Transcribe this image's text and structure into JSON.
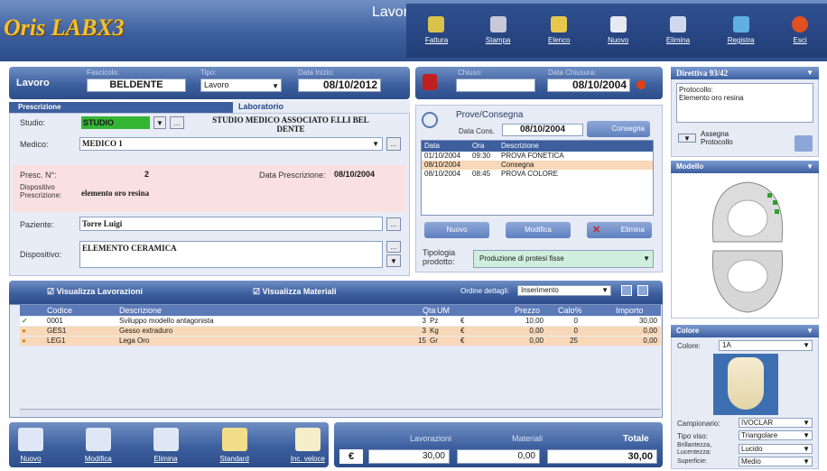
{
  "header": {
    "logo": "Oris LABX3",
    "title": "Lavori",
    "toolbar": [
      {
        "label": "Fattura",
        "icon": "invoice-icon",
        "color": "#d9c24a"
      },
      {
        "label": "Stampa",
        "icon": "print-icon",
        "color": "#c8c8d8"
      },
      {
        "label": "Elenco",
        "icon": "list-icon",
        "color": "#e7c84d"
      },
      {
        "label": "Nuovo",
        "icon": "new-icon",
        "color": "#e8e8f0"
      },
      {
        "label": "Elimina",
        "icon": "delete-icon",
        "color": "#d0d8ee"
      },
      {
        "label": "Registra",
        "icon": "save-icon",
        "color": "#5fb0e0"
      },
      {
        "label": "Esci",
        "icon": "exit-icon",
        "color": "#e05020"
      }
    ]
  },
  "lavoro": {
    "title": "Lavoro",
    "fascicolo_label": "Fascicolo:",
    "fascicolo": "BELDENTE",
    "tipo_label": "Tipo:",
    "tipo": "Lavoro",
    "data_inizio_label": "Data Inizio:",
    "data_inizio": "08/10/2012"
  },
  "chiusura": {
    "chiuso_label": "Chiuso:",
    "chiuso": "",
    "data_label": "Data Chiusura:",
    "data": "08/10/2004"
  },
  "tabs": {
    "prescrizione": "Prescrizione",
    "laboratorio": "Laboratorio"
  },
  "form": {
    "studio_label": "Studio:",
    "studio": "STUDIO",
    "studio_name": "STUDIO MEDICO ASSOCIATO F.LLI BEL DENTE",
    "medico_label": "Medico:",
    "medico": "MEDICO 1",
    "presc_label": "Presc. N°:",
    "presc": "2",
    "data_presc_label": "Data Prescrizione:",
    "data_presc": "08/10/2004",
    "disp_presc_label": "Dispositivo Prescrizione:",
    "disp_presc": "elemento oro resina",
    "paziente_label": "Paziente:",
    "paziente": "Torre Luigi",
    "dispositivo_label": "Dispositivo:",
    "dispositivo": "ELEMENTO CERAMICA",
    "dots": "..."
  },
  "prove": {
    "title": "Prove/Consegna",
    "data_cons_label": "Data Cons.",
    "data_cons": "08/10/2004",
    "consegna_btn": "Consegna",
    "cols": [
      "Data",
      "Ora",
      "Descrizione"
    ],
    "rows": [
      [
        "01/10/2004",
        "09:30",
        "PROVA FONETICA"
      ],
      [
        "08/10/2004",
        "",
        "Consegna"
      ],
      [
        "08/10/2004",
        "08:45",
        "PROVA COLORE"
      ]
    ],
    "btn_nuovo": "Nuovo",
    "btn_modifica": "Modifica",
    "btn_elimina": "Elimina",
    "tipologia_label": "Tipologia prodotto:",
    "tipologia": "Produzione di protesi fisse"
  },
  "direttiva": {
    "title": "Direttiva 93/42",
    "protocollo_label": "Protocollo:",
    "protocollo": "Elemento oro resina",
    "assegna": "Assegna Protocollo"
  },
  "modello": {
    "title": "Modello"
  },
  "colore": {
    "title": "Colore",
    "colore_label": "Colore:",
    "colore": "1A",
    "camp_label": "Campionario:",
    "camp": "IVOCLAR",
    "tipo_label": "Tipo viso:",
    "tipo": "Triangolare",
    "bril_label": "Brillantezza, Lucentezza:",
    "bril": "Lucido",
    "sup_label": "Superficie:",
    "sup": "Medio"
  },
  "lav": {
    "vis_lav": "Visualizza Lavorazioni",
    "vis_mat": "Visualizza Materiali",
    "ordine_label": "Ordine dettagli:",
    "ordine": "Inserimento",
    "cols": [
      "Codice",
      "Descrizione",
      "Qta",
      "UM",
      "",
      "Prezzo",
      "Calo%",
      "Importo"
    ],
    "rows": [
      [
        "0001",
        "Sviluppo modello antagonista",
        "3",
        "Pz",
        "€",
        "10,00",
        "0",
        "30,00"
      ],
      [
        "GES1",
        "Gesso extraduro",
        "3",
        "Kg",
        "€",
        "0,00",
        "0",
        "0,00"
      ],
      [
        "LEG1",
        "Lega Oro",
        "15",
        "Gr",
        "€",
        "0,00",
        "25",
        "0,00"
      ]
    ]
  },
  "bottom": {
    "buttons": [
      "Nuovo",
      "Modifica",
      "Elimina",
      "Standard",
      "Inc. veloce"
    ],
    "lav_label": "Lavorazioni",
    "mat_label": "Materiali",
    "tot_label": "Totale",
    "euro": "€",
    "lav": "30,00",
    "mat": "0,00",
    "tot": "30,00"
  }
}
